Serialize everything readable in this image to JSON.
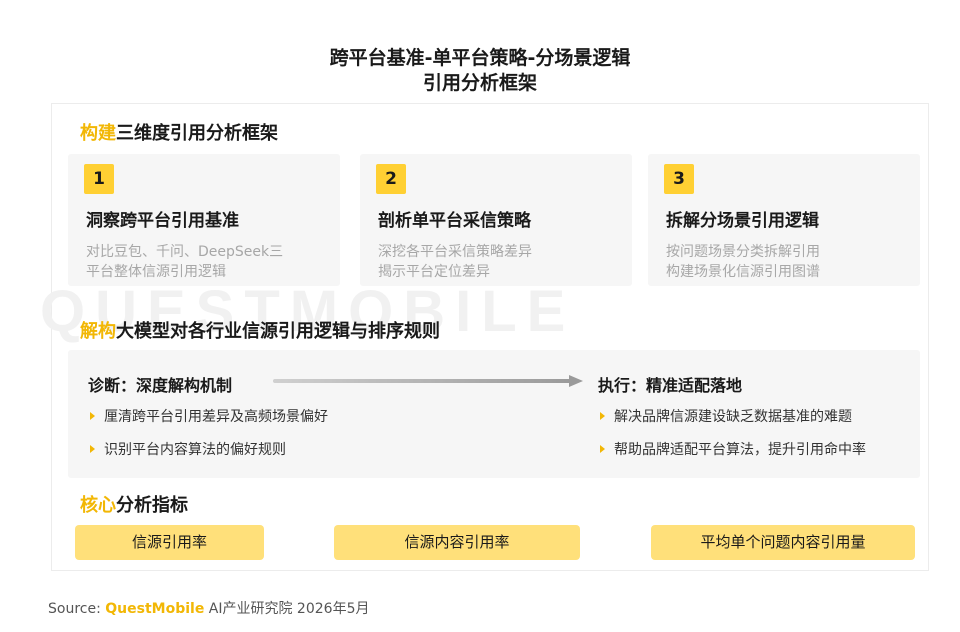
{
  "title": {
    "line1": "跨平台基准-单平台策略-分场景逻辑",
    "line2": "引用分析框架"
  },
  "watermark": "QUESTMOBILE",
  "section1": {
    "highlight": "构建",
    "rest": "三维度引用分析框架"
  },
  "cards": [
    {
      "number": "1",
      "title": "洞察跨平台引用基准",
      "desc": [
        "对比豆包、千问、DeepSeek三",
        "平台整体信源引用逻辑"
      ]
    },
    {
      "number": "2",
      "title": "剖析单平台采信策略",
      "desc": [
        "深挖各平台采信策略差异",
        "揭示平台定位差异"
      ]
    },
    {
      "number": "3",
      "title": "拆解分场景引用逻辑",
      "desc": [
        "按问题场景分类拆解引用",
        "构建场景化信源引用图谱"
      ]
    }
  ],
  "section2": {
    "highlight": "解构",
    "rest": "大模型对各行业信源引用逻辑与排序规则"
  },
  "diagnosis": {
    "label": "诊断：深度解构机制",
    "bullets": [
      "厘清跨平台引用差异及高频场景偏好",
      "识别平台内容算法的偏好规则"
    ]
  },
  "execution": {
    "label": "执行：精准适配落地",
    "bullets": [
      "解决品牌信源建设缺乏数据基准的难题",
      "帮助品牌适配平台算法，提升引用命中率"
    ]
  },
  "section3": {
    "highlight": "核心",
    "rest": "分析指标"
  },
  "metrics": [
    "信源引用率",
    "信源内容引用率",
    "平均单个问题内容引用量"
  ],
  "source": {
    "prefix": "Source:",
    "brand": "QuestMobile",
    "rest": "AI产业研究院 2026年5月"
  },
  "colors": {
    "accent": "#f2b705",
    "badge": "#ffd033",
    "metric_bg": "#ffe07a",
    "panel_bg": "#f6f6f6"
  }
}
